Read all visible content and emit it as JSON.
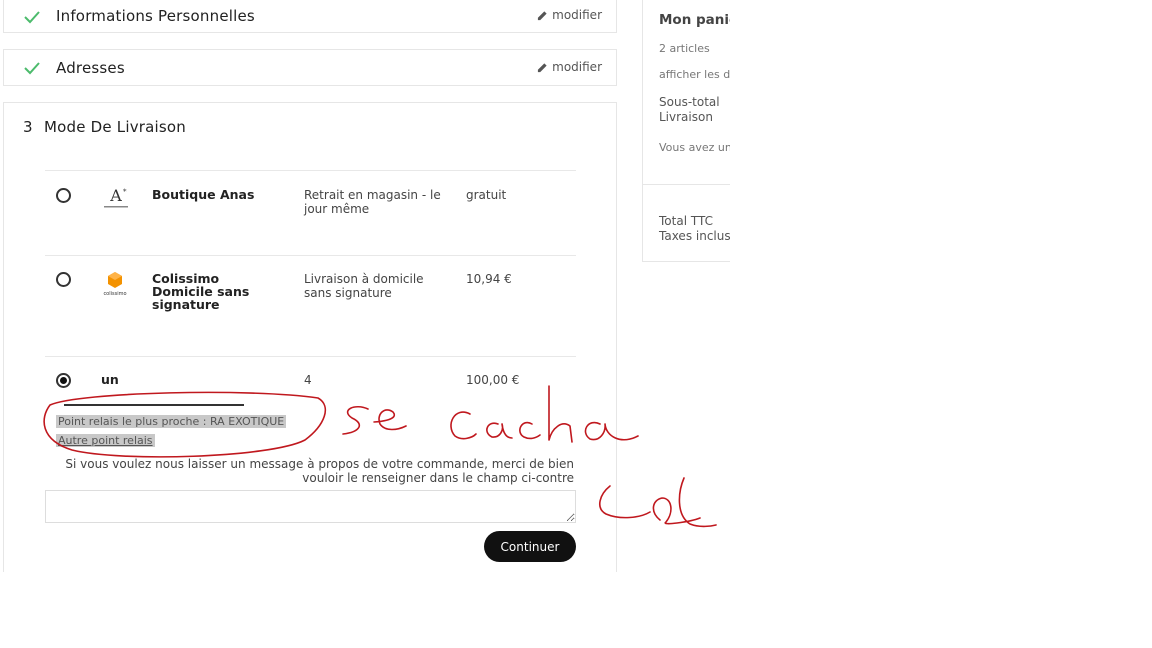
{
  "steps": {
    "personal": {
      "title": "Informations Personnelles",
      "modify_label": "modifier"
    },
    "addresses": {
      "title": "Adresses",
      "modify_label": "modifier"
    },
    "delivery": {
      "number": "3",
      "title": "Mode De Livraison"
    }
  },
  "carriers": [
    {
      "name": "Boutique Anas",
      "delay": "Retrait en magasin - le jour même",
      "price": "gratuit",
      "selected": false,
      "logo": "anas-logo"
    },
    {
      "name": "Colissimo Domicile sans signature",
      "delay": "Livraison à domicile sans signature",
      "price": "10,94 €",
      "selected": false,
      "logo": "colissimo-logo",
      "logo_caption": "colissimo"
    },
    {
      "name": "un",
      "delay": "4",
      "price": "100,00 €",
      "selected": true
    }
  ],
  "relay": {
    "nearest": "Point relais le plus proche : RA EXOTIQUE",
    "other_link": "Autre point relais"
  },
  "message": {
    "label": "Si vous voulez nous laisser un message à propos de votre commande, merci de bien vouloir le renseigner dans le champ ci-contre",
    "value": ""
  },
  "continue_label": "Continuer",
  "cart": {
    "title": "Mon panier",
    "count": "2 articles",
    "show_details": "afficher les détails",
    "subtotal_label": "Sous-total",
    "shipping_label": "Livraison",
    "voucher_text": "Vous avez un code promo ?",
    "total_label": "Total TTC",
    "taxes_label": "Taxes incluses"
  },
  "annotation": {
    "color": "#c0181e"
  }
}
